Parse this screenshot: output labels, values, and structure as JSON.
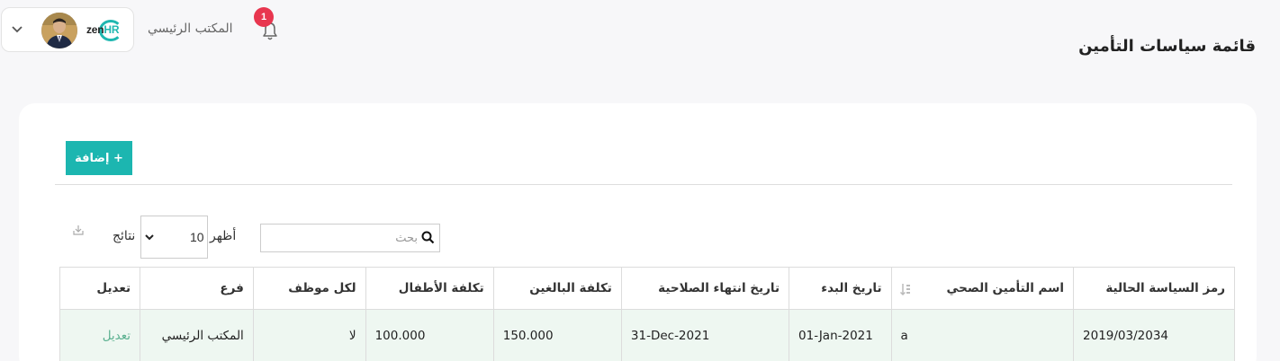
{
  "header": {
    "page_title": "قائمة سياسات التأمين",
    "branch_name": "المكتب الرئيسي",
    "notification_count": "1",
    "logo_text_a": "zen",
    "logo_text_b": "HR"
  },
  "toolbar": {
    "add_label": "+ إضافة",
    "show_label": "أظهر",
    "page_size": "10",
    "results_label": "نتائج",
    "search_placeholder": "بحث"
  },
  "table": {
    "columns": [
      "رمز السياسة الحالية",
      "اسم التأمين الصحي",
      "تاريخ البدء",
      "تاريخ انتهاء الصلاحية",
      "تكلفة البالغين",
      "تكلفة الأطفال",
      "لكل موظف",
      "فرع",
      "تعديل"
    ],
    "rows": [
      [
        "2019/03/2034",
        "a",
        "01-Jan-2021",
        "31-Dec-2021",
        "150.000",
        "100.000",
        "لا",
        "المكتب الرئيسي",
        "تعديل"
      ]
    ]
  },
  "colors": {
    "accent": "#1cb6b0",
    "badge": "#e8364f",
    "row_bg": "#eef7f1",
    "edit_link": "#5ab08f"
  },
  "icons": [
    "chevron-down-icon",
    "bell-icon",
    "search-icon",
    "export-icon",
    "sort-icon",
    "avatar"
  ]
}
